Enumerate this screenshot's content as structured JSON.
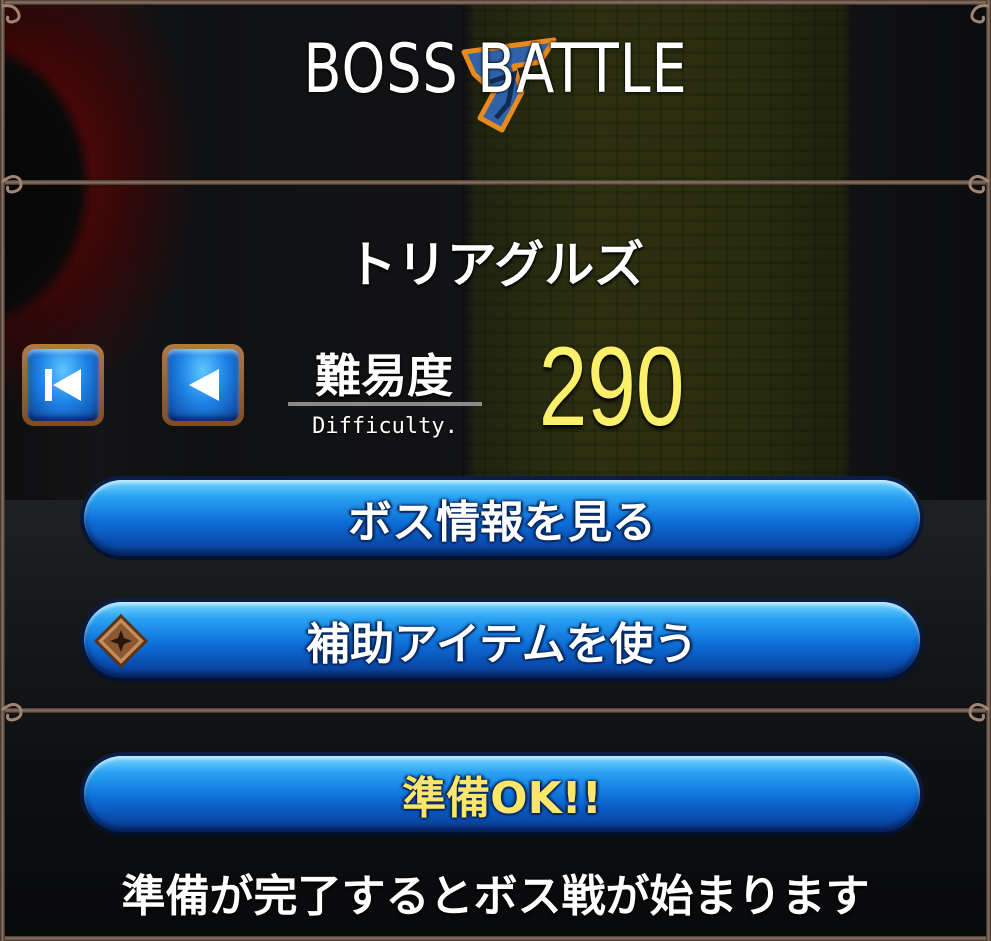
{
  "header": {
    "title": "BOSS BATTLE"
  },
  "boss": {
    "name": "トリアグルズ"
  },
  "difficulty": {
    "label": "難易度",
    "sublabel": "Difficulty.",
    "value": "290"
  },
  "buttons": {
    "boss_info": "ボス情報を見る",
    "use_item": "補助アイテムを使う",
    "ready": "準備OK!!"
  },
  "footer": {
    "message": "準備が完了するとボス戦が始まります"
  },
  "icons": {
    "first": "skip-to-first-icon",
    "prev": "previous-icon",
    "item": "item-gem-icon",
    "crest": "crown-crest-icon"
  },
  "colors": {
    "difficulty_value": "#fbf06a",
    "button_blue": "#0d6fd8",
    "ready_text": "#fbe56b"
  }
}
